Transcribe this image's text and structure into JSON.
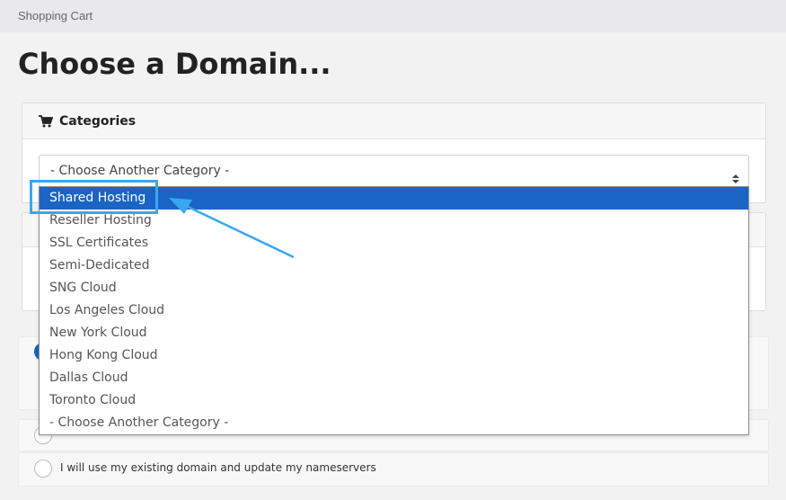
{
  "header": {
    "breadcrumb": "Shopping Cart",
    "title": "Choose a Domain..."
  },
  "categories_panel": {
    "title": "Categories",
    "icon": "shopping-cart-icon",
    "select_value": "- Choose Another Category -"
  },
  "dropdown": {
    "options": [
      "Shared Hosting",
      "Reseller Hosting",
      "SSL Certificates",
      "Semi-Dedicated",
      "SNG Cloud",
      "Los Angeles Cloud",
      "New York Cloud",
      "Hong Kong Cloud",
      "Dallas Cloud",
      "Toronto Cloud",
      "- Choose Another Category -"
    ],
    "highlighted": "Shared Hosting"
  },
  "domain_options": {
    "existing_domain_label": "I will use my existing domain and update my nameservers"
  },
  "colors": {
    "accent": "#1a64c6",
    "annotation": "#3aa6f0"
  }
}
